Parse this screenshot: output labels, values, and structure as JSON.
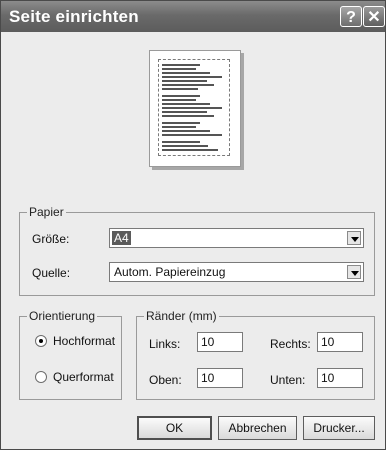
{
  "window": {
    "title": "Seite einrichten",
    "help_label": "?",
    "close_label": "✕"
  },
  "preview": {},
  "paper": {
    "group_label": "Papier",
    "size_label": "Größe:",
    "size_value": "A4",
    "source_label": "Quelle:",
    "source_value": "Autom. Papiereinzug"
  },
  "orientation": {
    "group_label": "Orientierung",
    "portrait_label": "Hochformat",
    "landscape_label": "Querformat",
    "selected": "Hochformat"
  },
  "margins": {
    "group_label": "Ränder (mm)",
    "left_label": "Links:",
    "left_value": "10",
    "right_label": "Rechts:",
    "right_value": "10",
    "top_label": "Oben:",
    "top_value": "10",
    "bottom_label": "Unten:",
    "bottom_value": "10"
  },
  "buttons": {
    "ok": "OK",
    "cancel": "Abbrechen",
    "printer": "Drucker..."
  }
}
